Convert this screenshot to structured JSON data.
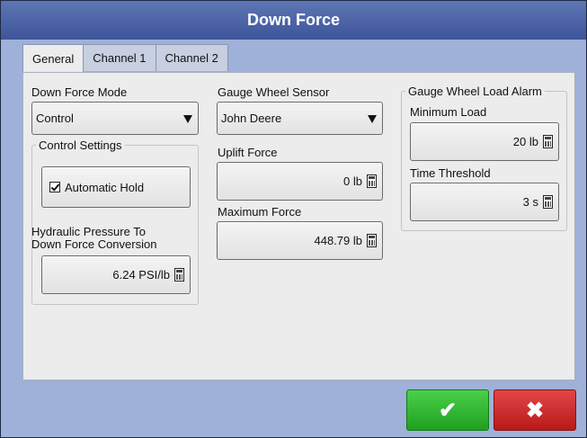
{
  "window": {
    "title": "Down Force"
  },
  "tabs": [
    {
      "label": "General",
      "active": true
    },
    {
      "label": "Channel 1",
      "active": false
    },
    {
      "label": "Channel 2",
      "active": false
    }
  ],
  "general": {
    "mode_label": "Down Force Mode",
    "mode_value": "Control",
    "control_settings_title": "Control Settings",
    "automatic_hold_label": "Automatic Hold",
    "automatic_hold_checked": true,
    "conversion_label_line1": "Hydraulic Pressure To",
    "conversion_label_line2": "Down Force Conversion",
    "conversion_value": "6.24 PSI/lb",
    "sensor_label": "Gauge Wheel Sensor",
    "sensor_value": "John Deere",
    "uplift_label": "Uplift Force",
    "uplift_value": "0 lb",
    "max_label": "Maximum Force",
    "max_value": "448.79 lb",
    "alarm_title": "Gauge Wheel Load Alarm",
    "min_load_label": "Minimum Load",
    "min_load_value": "20 lb",
    "time_label": "Time Threshold",
    "time_value": "3 s"
  },
  "footer": {
    "ok_icon": "✔",
    "cancel_icon": "✖"
  },
  "icons": {
    "dropdown": "triangle-down-icon",
    "calculator": "calculator-icon",
    "ok": "checkmark-icon",
    "cancel": "x-icon"
  },
  "colors": {
    "title_bar": "#4a62a8",
    "frame": "#9fb1d8",
    "ok_button": "#2db82d",
    "cancel_button": "#d02c2c"
  }
}
